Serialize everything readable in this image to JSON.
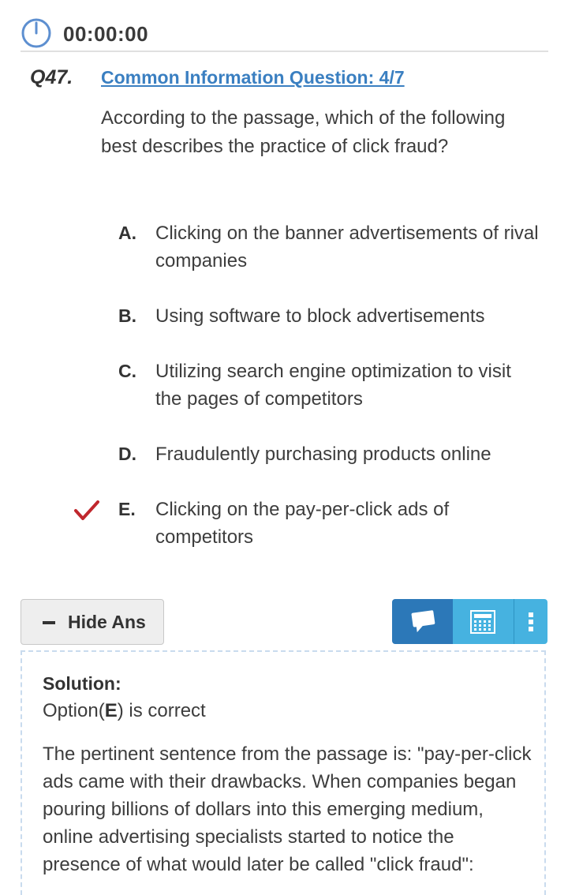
{
  "timer": {
    "value": "00:00:00",
    "icon": "clock-icon"
  },
  "question": {
    "number": "Q47.",
    "link_label": "Common Information Question: 4/7",
    "text": "According to the passage, which of the following best describes the practice of click fraud?"
  },
  "options": [
    {
      "letter": "A.",
      "text": "Clicking on the banner advertisements of rival companies",
      "correct": false
    },
    {
      "letter": "B.",
      "text": "Using software to block advertisements",
      "correct": false
    },
    {
      "letter": "C.",
      "text": "Utilizing search engine optimization to visit the pages of competitors",
      "correct": false
    },
    {
      "letter": "D.",
      "text": "Fraudulently purchasing products online",
      "correct": false
    },
    {
      "letter": "E.",
      "text": "Clicking on the pay-per-click ads of competitors",
      "correct": true
    }
  ],
  "controls": {
    "hide_ans_label": "Hide Ans",
    "toolbar_icons": [
      "chat-icon",
      "calculator-icon",
      "more-vertical-icon"
    ]
  },
  "solution": {
    "title": "Solution:",
    "option_prefix": "Option(",
    "option_letter": "E",
    "option_suffix": ") is correct",
    "body": "The pertinent sentence from the passage is: \"pay-per-click ads came with their drawbacks. When companies began pouring billions of dollars into this emerging medium, online advertising specialists started to notice the presence of what would later be called \"click fraud\":"
  },
  "colors": {
    "accent_link": "#3a7fc1",
    "check": "#c0272d",
    "toolbar_dark": "#2c78b8",
    "toolbar_light": "#46b2e0",
    "timer_icon": "#5d8fd0"
  }
}
